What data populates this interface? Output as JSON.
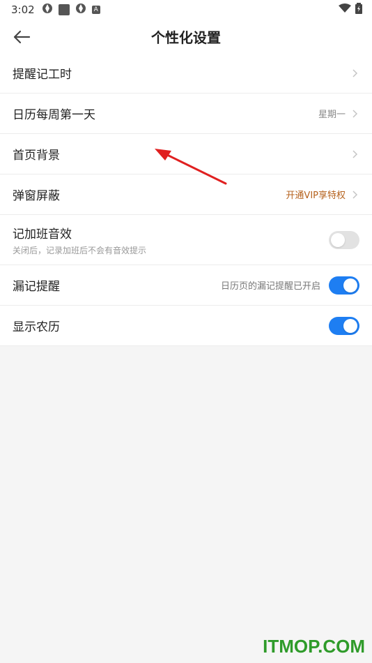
{
  "status_bar": {
    "time": "3:02",
    "notice_a": "A"
  },
  "header": {
    "title": "个性化设置"
  },
  "items": [
    {
      "label": "提醒记工时"
    },
    {
      "label": "日历每周第一天",
      "value": "星期一"
    },
    {
      "label": "首页背景"
    },
    {
      "label": "弹窗屏蔽",
      "value": "开通VIP享特权"
    },
    {
      "label": "记加班音效",
      "sub": "关闭后，记录加班后不会有音效提示",
      "toggle": "off"
    },
    {
      "label": "漏记提醒",
      "hint": "日历页的漏记提醒已开启",
      "toggle": "on"
    },
    {
      "label": "显示农历",
      "toggle": "on"
    }
  ],
  "colors": {
    "accent": "#1e7ef2",
    "vip": "#b5611c",
    "annotation": "#e02020",
    "watermark": "#2f9b2a"
  },
  "watermark": "ITMOP.COM"
}
